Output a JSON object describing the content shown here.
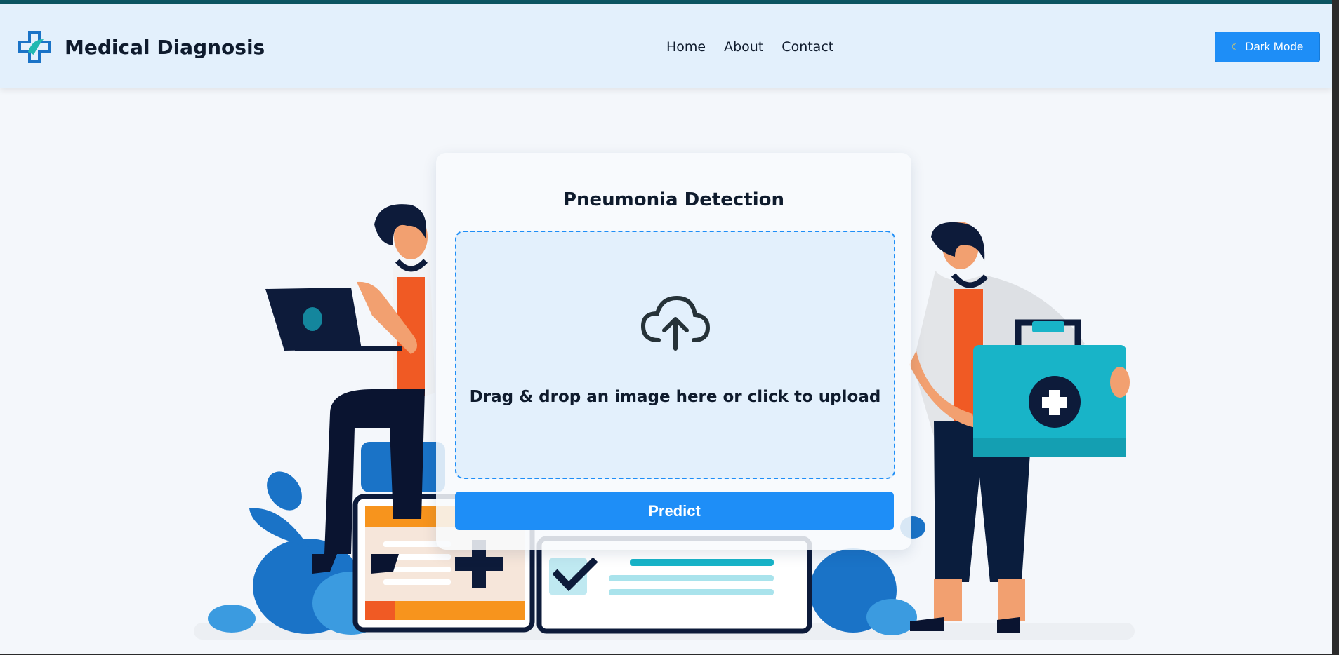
{
  "brand": {
    "title": "Medical Diagnosis",
    "logo_icon": "medical-cross-logo"
  },
  "nav": {
    "links": [
      "Home",
      "About",
      "Contact"
    ]
  },
  "theme_toggle": {
    "icon": "moon",
    "label": "Dark Mode"
  },
  "card": {
    "title": "Pneumonia Detection",
    "dropzone_text": "Drag & drop an image here or click to upload",
    "upload_icon": "cloud-upload",
    "predict_label": "Predict"
  },
  "colors": {
    "accent": "#1e8ef7",
    "navbar_bg": "#e3f0fc",
    "top_strip": "#0c5562",
    "teal_kit": "#18b4c8",
    "orange": "#f05a24",
    "navy": "#0d1b3a"
  }
}
